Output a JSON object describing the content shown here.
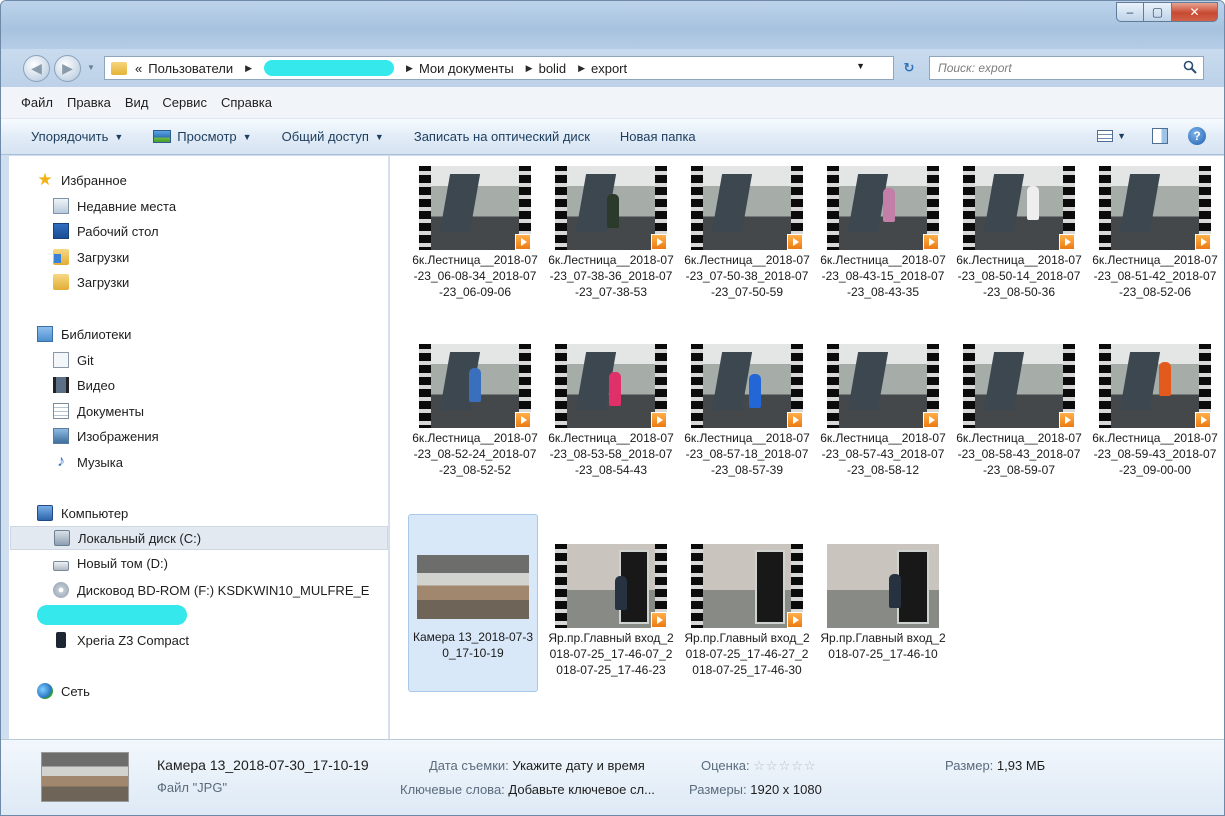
{
  "window": {
    "min": "–",
    "max": "▢",
    "close": "✕"
  },
  "address": {
    "prefix": "«",
    "crumbs": [
      "Пользователи",
      "Мои документы",
      "bolid",
      "export"
    ]
  },
  "search": {
    "placeholder": "Поиск: export"
  },
  "menu": [
    "Файл",
    "Правка",
    "Вид",
    "Сервис",
    "Справка"
  ],
  "toolbar": {
    "organize": "Упорядочить",
    "view": "Просмотр",
    "share": "Общий доступ",
    "burn": "Записать на оптический диск",
    "new_folder": "Новая папка"
  },
  "nav": {
    "favorites": "Избранное",
    "recent": "Недавние места",
    "desktop": "Рабочий стол",
    "downloads1": "Загрузки",
    "downloads2": "Загрузки",
    "libraries": "Библиотеки",
    "git": "Git",
    "video": "Видео",
    "documents": "Документы",
    "images": "Изображения",
    "music": "Музыка",
    "computer": "Компьютер",
    "local_disk": "Локальный диск (C:)",
    "new_volume": "Новый том (D:)",
    "bd_rom": "Дисковод BD-ROM (F:) KSDKWIN10_MULFRE_E",
    "xperia": "Xperia Z3 Compact",
    "network": "Сеть"
  },
  "files": [
    {
      "name": "6к.Лестница__2018-07-23_06-08-34_2018-07-23_06-09-06"
    },
    {
      "name": "6к.Лестница__2018-07-23_07-38-36_2018-07-23_07-38-53"
    },
    {
      "name": "6к.Лестница__2018-07-23_07-50-38_2018-07-23_07-50-59"
    },
    {
      "name": "6к.Лестница__2018-07-23_08-43-15_2018-07-23_08-43-35"
    },
    {
      "name": "6к.Лестница__2018-07-23_08-50-14_2018-07-23_08-50-36"
    },
    {
      "name": "6к.Лестница__2018-07-23_08-51-42_2018-07-23_08-52-06"
    },
    {
      "name": "6к.Лестница__2018-07-23_08-52-24_2018-07-23_08-52-52"
    },
    {
      "name": "6к.Лестница__2018-07-23_08-53-58_2018-07-23_08-54-43"
    },
    {
      "name": "6к.Лестница__2018-07-23_08-57-18_2018-07-23_08-57-39"
    },
    {
      "name": "6к.Лестница__2018-07-23_08-57-43_2018-07-23_08-58-12"
    },
    {
      "name": "6к.Лестница__2018-07-23_08-58-43_2018-07-23_08-59-07"
    },
    {
      "name": "6к.Лестница__2018-07-23_08-59-43_2018-07-23_09-00-00"
    },
    {
      "name": "Камера 13_2018-07-30_17-10-19"
    },
    {
      "name": "Яр.пр.Главный вход_2018-07-25_17-46-07_2018-07-25_17-46-23"
    },
    {
      "name": "Яр.пр.Главный вход_2018-07-25_17-46-27_2018-07-25_17-46-30"
    },
    {
      "name": "Яр.пр.Главный вход_2018-07-25_17-46-10"
    }
  ],
  "details": {
    "name": "Камера 13_2018-07-30_17-10-19",
    "type": "Файл \"JPG\"",
    "date_label": "Дата съемки:",
    "date_value": "Укажите дату и время",
    "rating_label": "Оценка:",
    "rating_stars": "☆☆☆☆☆",
    "size_label": "Размер:",
    "size_value": "1,93 МБ",
    "keywords_label": "Ключевые слова:",
    "keywords_value": "Добавьте ключевое сл...",
    "dimensions_label": "Размеры:",
    "dimensions_value": "1920 x 1080"
  }
}
